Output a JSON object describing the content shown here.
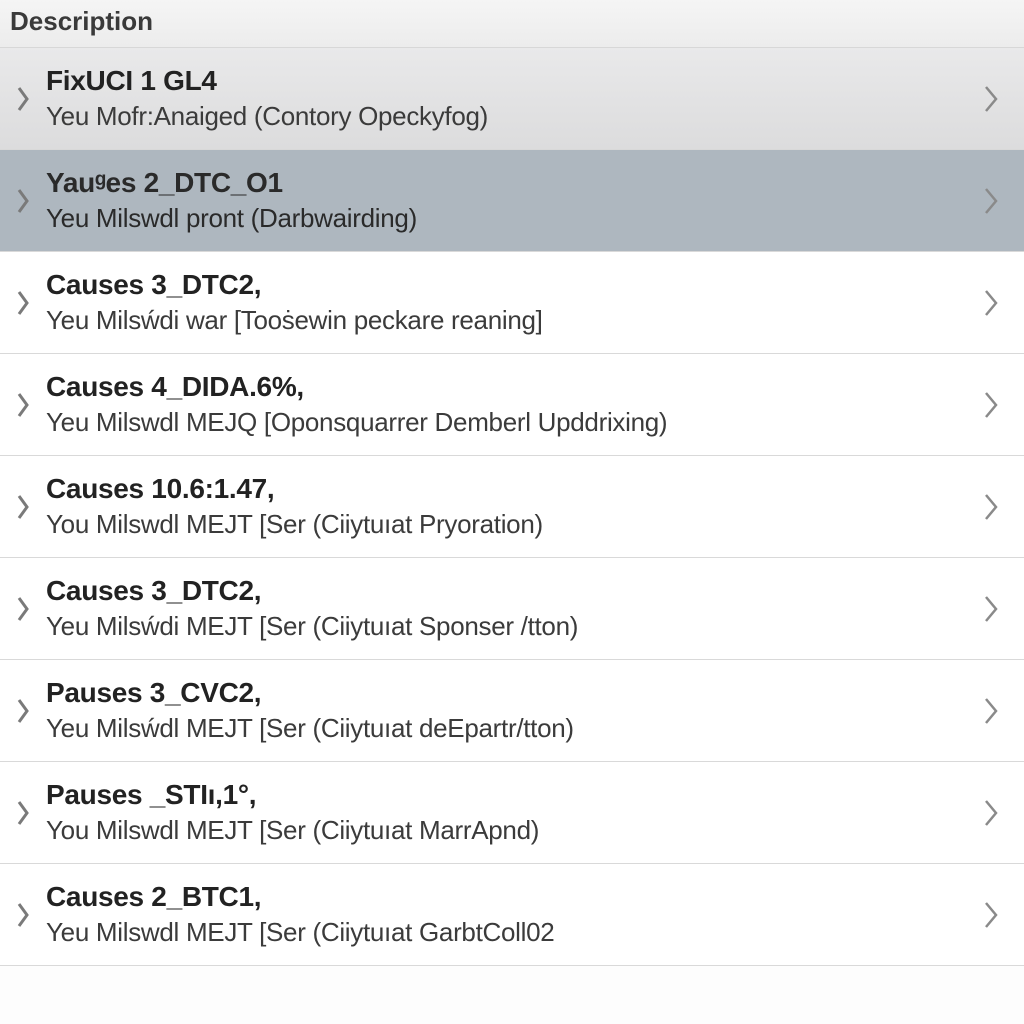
{
  "header": {
    "title": "Description"
  },
  "rows": [
    {
      "title": "FixUCI 1 GL4",
      "subtitle": "Yeu Mofr:Anaiged (Contory Opeckyfog)",
      "variant": "shaded"
    },
    {
      "title": "Yauᵍes 2_DTC_O1",
      "subtitle": "Yeu Milswdl pront (Darbwairding)",
      "variant": "selected"
    },
    {
      "title": "Causes 3_DTC2,",
      "subtitle": "Yeu Milsẃdi war [Tooṡewin peckare reaning]",
      "variant": "normal"
    },
    {
      "title": "Causes 4_DIDA.6%,",
      "subtitle": "Yeu Milswdl MEJQ [Oponsquarrer Demberl Upddrixing)",
      "variant": "normal"
    },
    {
      "title": "Causes 10.6:1.47,",
      "subtitle": "You Milswdl MEJT [Ser (Ciiytuıat Pryoration)",
      "variant": "normal"
    },
    {
      "title": "Causes 3_DTC2,",
      "subtitle": "Yeu Milsẃdi MEJT [Ser (Ciiytuıat Sponser /tton)",
      "variant": "normal"
    },
    {
      "title": "Pauses 3_CVC2,",
      "subtitle": "Yeu Milsẃdl MEJT [Ser (Ciiytuıat deEpartr/tton)",
      "variant": "normal"
    },
    {
      "title": "Pauses _STIı,1°,",
      "subtitle": "You Milswdl MEJT [Ser (Ciiytuıat MarrApnd)",
      "variant": "normal"
    },
    {
      "title": "Causes 2_BTC1,",
      "subtitle": "Yeu Milswdl MEJT [Ser (Ciiytuıat GarbtColl02",
      "variant": "normal"
    }
  ]
}
